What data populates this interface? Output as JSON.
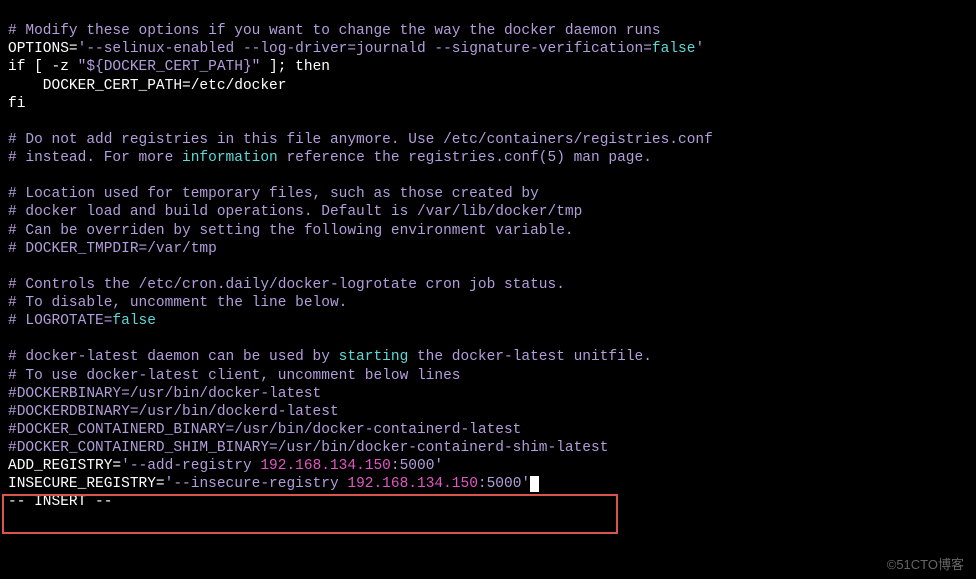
{
  "lines": {
    "l1_comment": "# Modify these options if you want to change the way the docker daemon runs",
    "l2_options_key": "OPTIONS=",
    "l2_options_val1": "'--selinux-enabled --log-driver=journald --signature-verification=",
    "l2_options_false": "false",
    "l2_options_val2": "'",
    "l3_if": "if",
    "l3_cond": " [ -z ",
    "l3_var": "\"${DOCKER_CERT_PATH}\"",
    "l3_then": " ]; then",
    "l4_body": "    DOCKER_CERT_PATH=/etc/docker",
    "l5_fi": "fi",
    "l7_comment": "# Do not add registries in this file anymore. Use /etc/containers/registries.conf",
    "l8_comment1": "# instead. For more ",
    "l8_info": "information",
    "l8_comment2": " reference the registries.conf(5) man page.",
    "l10_comment": "# Location used for temporary files, such as those created by",
    "l11_comment": "# docker load and build operations. Default is /var/lib/docker/tmp",
    "l12_comment": "# Can be overriden by setting the following environment variable.",
    "l13_comment": "# DOCKER_TMPDIR=/var/tmp",
    "l15_comment": "# Controls the /etc/cron.daily/docker-logrotate cron job status.",
    "l16_comment": "# To disable, uncomment the line below.",
    "l17_comment1": "# LOGROTATE=",
    "l17_false": "false",
    "l19_comment1": "# docker-latest daemon can be used by ",
    "l19_starting": "starting",
    "l19_comment2": " the docker-latest unitfile.",
    "l20_comment": "# To use docker-latest client, uncomment below lines",
    "l21": "#DOCKERBINARY=/usr/bin/docker-latest",
    "l22": "#DOCKERDBINARY=/usr/bin/dockerd-latest",
    "l23": "#DOCKER_CONTAINERD_BINARY=/usr/bin/docker-containerd-latest",
    "l24": "#DOCKER_CONTAINERD_SHIM_BINARY=/usr/bin/docker-containerd-shim-latest",
    "l25_key": "ADD_REGISTRY=",
    "l25_val": "'--add-registry ",
    "l25_ip": "192.168.134.150",
    "l25_port": ":5000'",
    "l26_key": "INSECURE_REGISTRY=",
    "l26_val": "'--insecure-registry ",
    "l26_ip": "192.168.134.150",
    "l26_port": ":5000'",
    "mode": "-- INSERT --"
  },
  "watermark": "©51CTO博客"
}
